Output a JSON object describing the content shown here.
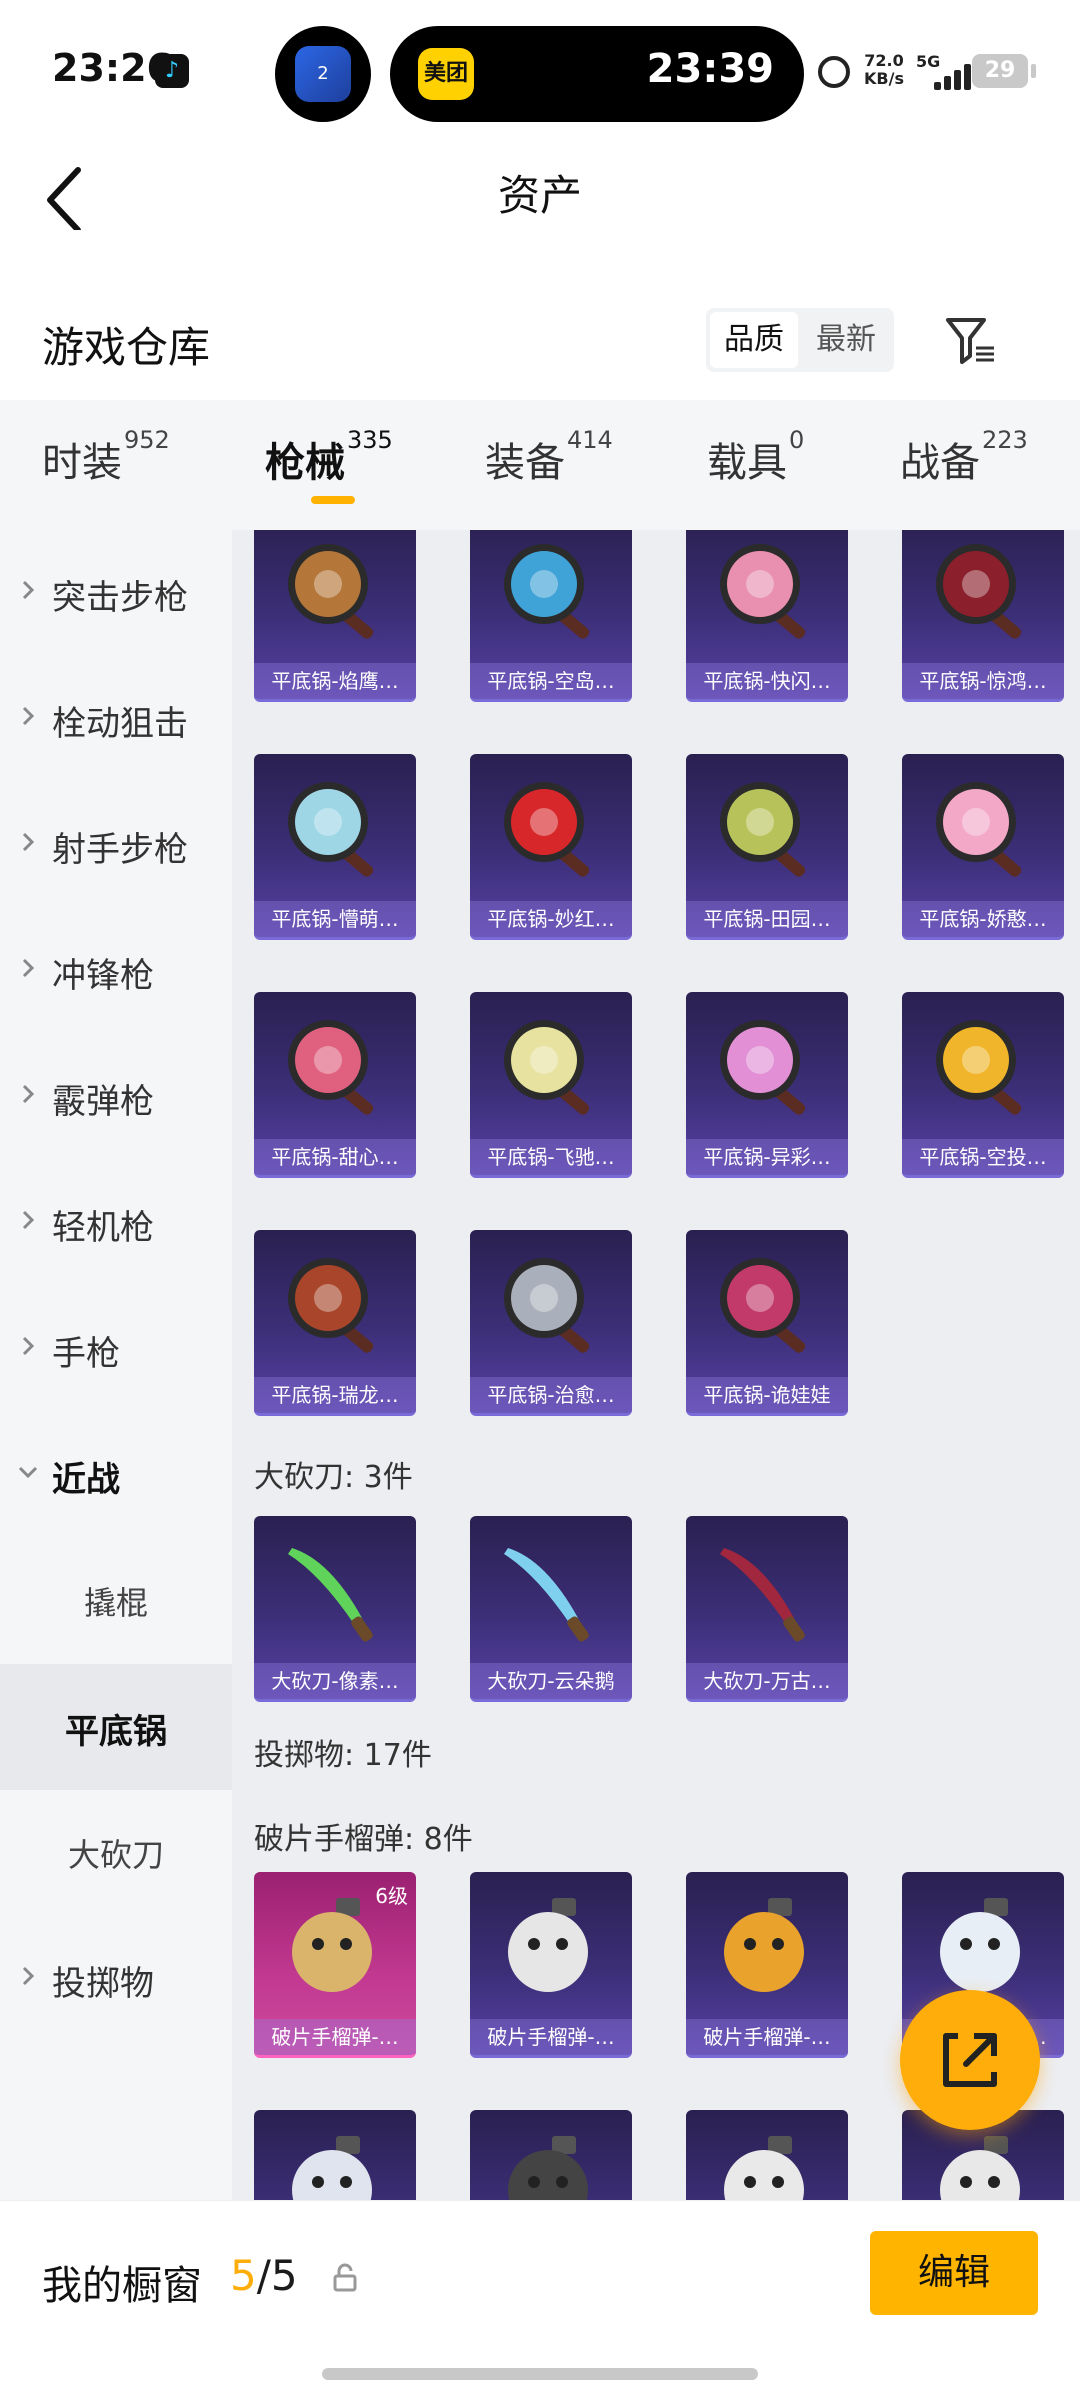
{
  "status_bar": {
    "time": "23:26",
    "island_app": "美团",
    "island_time": "23:39",
    "island_left_badge": "2",
    "net_speed_value": "72.0",
    "net_speed_unit": "KB/s",
    "network": "5G",
    "battery": "29"
  },
  "nav": {
    "title": "资产"
  },
  "warehouse": {
    "title": "游戏仓库",
    "sort_options": [
      "品质",
      "最新"
    ]
  },
  "tabs": [
    {
      "label": "时装",
      "count": "952"
    },
    {
      "label": "枪械",
      "count": "335",
      "active": true
    },
    {
      "label": "装备",
      "count": "414"
    },
    {
      "label": "载具",
      "count": "0"
    },
    {
      "label": "战备",
      "count": "223"
    }
  ],
  "side_nav": [
    {
      "label": "突击步枪"
    },
    {
      "label": "栓动狙击"
    },
    {
      "label": "射手步枪"
    },
    {
      "label": "冲锋枪"
    },
    {
      "label": "霰弹枪"
    },
    {
      "label": "轻机枪"
    },
    {
      "label": "手枪"
    },
    {
      "label": "近战"
    },
    {
      "label": "撬棍"
    },
    {
      "label": "平底锅"
    },
    {
      "label": "大砍刀"
    },
    {
      "label": "投掷物"
    }
  ],
  "pans": [
    {
      "name": "平底锅-焰鹰…",
      "color": "#b5763a"
    },
    {
      "name": "平底锅-空岛…",
      "color": "#3fa3d8"
    },
    {
      "name": "平底锅-快闪…",
      "color": "#e98fb0"
    },
    {
      "name": "平底锅-惊鸿…",
      "color": "#8b1f2c"
    },
    {
      "name": "平底锅-懵萌…",
      "color": "#9fd6e6"
    },
    {
      "name": "平底锅-妙红…",
      "color": "#d8272b"
    },
    {
      "name": "平底锅-田园…",
      "color": "#b7c35a"
    },
    {
      "name": "平底锅-娇憨…",
      "color": "#f2a8c6"
    },
    {
      "name": "平底锅-甜心…",
      "color": "#e0607f"
    },
    {
      "name": "平底锅-飞驰…",
      "color": "#e7e2a0"
    },
    {
      "name": "平底锅-异彩…",
      "color": "#e28fd6"
    },
    {
      "name": "平底锅-空投…",
      "color": "#f0b52a"
    },
    {
      "name": "平底锅-瑞龙…",
      "color": "#a8452a"
    },
    {
      "name": "平底锅-治愈…",
      "color": "#aab0bb"
    },
    {
      "name": "平底锅-诡娃娃",
      "color": "#c23a6a"
    }
  ],
  "machete_label": "大砍刀: 3件",
  "machetes": [
    {
      "name": "大砍刀-像素…",
      "color": "#5fd35a"
    },
    {
      "name": "大砍刀-云朵鹅",
      "color": "#7fd0ef"
    },
    {
      "name": "大砍刀-万古…",
      "color": "#a0273d"
    }
  ],
  "throwables_label": "投掷物: 17件",
  "frag_label": "破片手榴弹: 8件",
  "grenades": [
    {
      "name": "破片手榴弹-…",
      "color": "#d9b46a",
      "level": "6级",
      "pink": true
    },
    {
      "name": "破片手榴弹-…",
      "color": "#e6e6e6"
    },
    {
      "name": "破片手榴弹-…",
      "color": "#e9a22c"
    },
    {
      "name": "破片手榴弹-…",
      "color": "#e8eef5"
    },
    {
      "name": "",
      "color": "#dfe4ee"
    },
    {
      "name": "",
      "color": "#444444"
    },
    {
      "name": "",
      "color": "#e9e9e9"
    },
    {
      "name": "",
      "color": "#e8e8e8"
    }
  ],
  "bottom": {
    "my_window": "我的橱窗",
    "used": "5",
    "total": "/5",
    "edit": "编辑"
  },
  "colors": {
    "accent": "#ffad0a",
    "tab_underline": "#ffb200"
  }
}
